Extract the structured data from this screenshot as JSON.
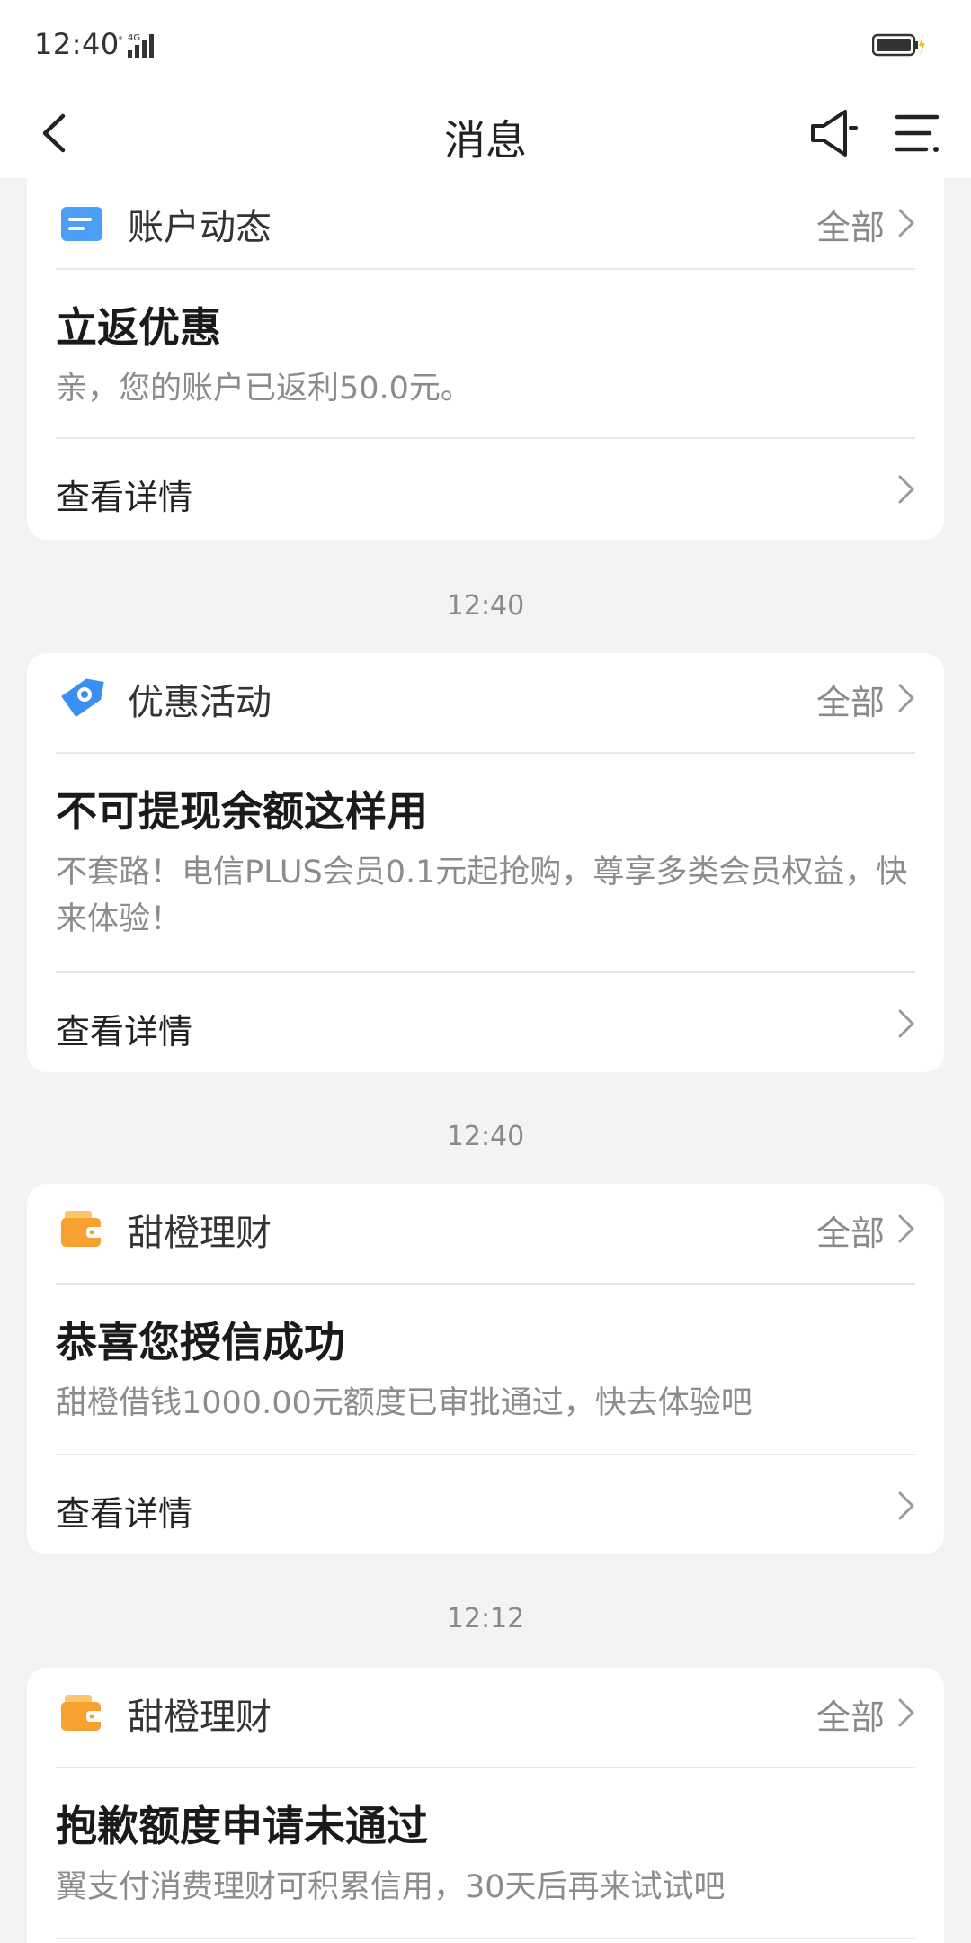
{
  "status_bar": {
    "time": "12:40",
    "network": "4G",
    "battery_state": "charging"
  },
  "nav": {
    "title": "消息"
  },
  "cards": [
    {
      "source": "账户动态",
      "icon": "account-doc-icon",
      "all_label": "全部",
      "title": "立返优惠",
      "body": "亲，您的账户已返利50.0元。",
      "detail_label": "查看详情"
    },
    {
      "time": "12:40",
      "source": "优惠活动",
      "icon": "promo-tag-icon",
      "all_label": "全部",
      "title": "不可提现余额这样用",
      "body": "不套路！电信PLUS会员0.1元起抢购，尊享多类会员权益，快来体验！",
      "detail_label": "查看详情"
    },
    {
      "time": "12:40",
      "source": "甜橙理财",
      "icon": "wallet-icon",
      "all_label": "全部",
      "title": "恭喜您授信成功",
      "body": "甜橙借钱1000.00元额度已审批通过，快去体验吧",
      "detail_label": "查看详情"
    },
    {
      "time": "12:12",
      "source": "甜橙理财",
      "icon": "wallet-icon",
      "all_label": "全部",
      "title": "抱歉额度申请未通过",
      "body": "翼支付消费理财可积累信用，30天后再来试试吧"
    }
  ],
  "colors": {
    "background": "#f3f3f3",
    "card": "#ffffff",
    "account_icon": "#4a9ef5",
    "promo_icon": "#3b8ff2",
    "wallet_icon": "#f7a130",
    "muted_text": "#8c8c8c"
  }
}
